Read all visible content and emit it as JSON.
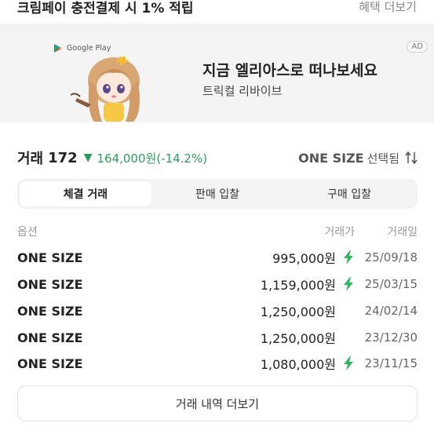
{
  "promo": {
    "text": "크림페이 충전결제 시 1% 적립",
    "link": "혜택 더보기"
  },
  "ad": {
    "store_name": "Google Play",
    "badge": "AD",
    "title": "지금 엘리아스로 떠나보세요",
    "subtitle": "트릭컬 리바이브"
  },
  "summary": {
    "trade_label": "거래",
    "trade_count": "172",
    "change_text": "164,000원(-14.2%)",
    "size_value": "ONE SIZE",
    "size_state": "선택됨",
    "change_color": "#2a9d5c"
  },
  "tabs": [
    {
      "label": "체결 거래",
      "active": true
    },
    {
      "label": "판매 입찰",
      "active": false
    },
    {
      "label": "구매 입찰",
      "active": false
    }
  ],
  "table": {
    "headers": {
      "option": "옵션",
      "price": "거래가",
      "date": "거래일"
    },
    "rows": [
      {
        "option": "ONE SIZE",
        "price": "995,000원",
        "fast": true,
        "date": "25/09/18"
      },
      {
        "option": "ONE SIZE",
        "price": "1,159,000원",
        "fast": true,
        "date": "25/03/15"
      },
      {
        "option": "ONE SIZE",
        "price": "1,250,000원",
        "fast": false,
        "date": "24/02/14"
      },
      {
        "option": "ONE SIZE",
        "price": "1,250,000원",
        "fast": false,
        "date": "23/12/30"
      },
      {
        "option": "ONE SIZE",
        "price": "1,080,000원",
        "fast": true,
        "date": "23/11/15"
      }
    ]
  },
  "more_button": "거래 내역 더보기",
  "icons": {
    "fast_delivery": "lightning-bolt-icon",
    "sort": "sort-arrows-icon",
    "down": "down-triangle-icon"
  },
  "colors": {
    "accent_green": "#2a9d5c",
    "bolt_green": "#31b55a"
  }
}
